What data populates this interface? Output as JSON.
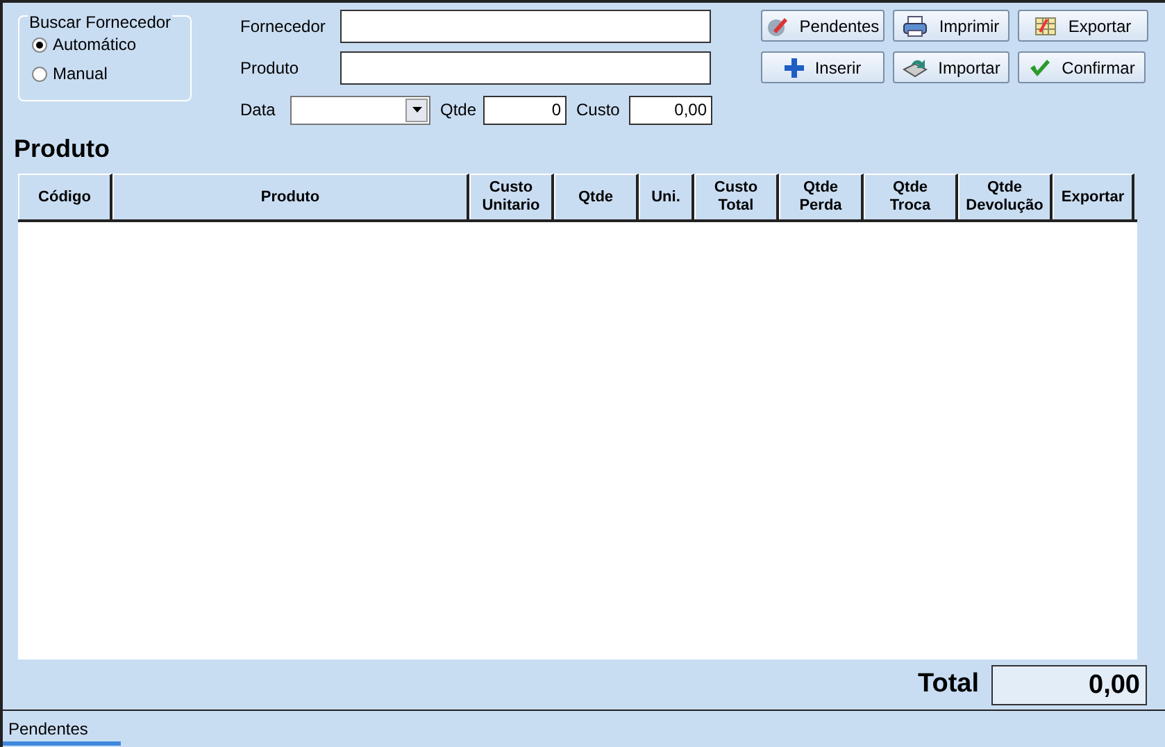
{
  "search_group": {
    "title": "Buscar Fornecedor",
    "options": [
      {
        "label": "Automático",
        "selected": true
      },
      {
        "label": "Manual",
        "selected": false
      }
    ]
  },
  "fields": {
    "fornecedor": {
      "label": "Fornecedor"
    },
    "produto": {
      "label": "Produto"
    },
    "data": {
      "label": "Data"
    },
    "qtde": {
      "label": "Qtde",
      "value": "0"
    },
    "custo": {
      "label": "Custo",
      "value": "0,00"
    }
  },
  "buttons": [
    {
      "label": "Pendentes",
      "kind": "pendentes"
    },
    {
      "label": "Imprimir",
      "kind": "print"
    },
    {
      "label": "Exportar",
      "kind": "export"
    },
    {
      "label": "Inserir",
      "kind": "add"
    },
    {
      "label": "Importar",
      "kind": "import"
    },
    {
      "label": "Confirmar",
      "kind": "confirm"
    }
  ],
  "section_title": "Produto",
  "table": {
    "columns": [
      {
        "label": "Código"
      },
      {
        "label": "Produto"
      },
      {
        "label": "Custo Unitario"
      },
      {
        "label": "Qtde"
      },
      {
        "label": "Uni."
      },
      {
        "label": "Custo Total"
      },
      {
        "label": "Qtde Perda"
      },
      {
        "label": "Qtde Troca"
      },
      {
        "label": "Qtde Devolução"
      },
      {
        "label": "Exportar"
      }
    ]
  },
  "total": {
    "label": "Total",
    "value": "0,00"
  },
  "tabs": [
    {
      "label": "Pendentes",
      "selected": true
    }
  ]
}
